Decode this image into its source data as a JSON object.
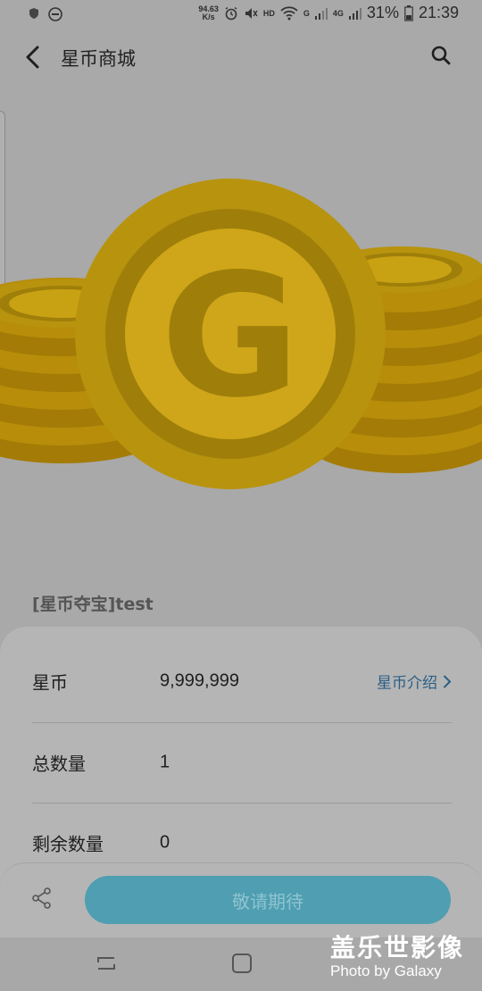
{
  "status_bar": {
    "net_speed_value": "94.63",
    "net_speed_unit": "K/s",
    "hd": "HD",
    "signal_tag_1": "G",
    "signal_tag_2": "4G",
    "battery": "31%",
    "time": "21:39"
  },
  "app_bar": {
    "title": "星币商城",
    "back_icon": "chevron-left-icon",
    "search_icon": "search-icon"
  },
  "hero": {
    "coin_letter": "G",
    "colors": {
      "coin_outer": "#b8930e",
      "coin_ring": "#9f7f0a",
      "coin_face": "#cfa619"
    }
  },
  "product": {
    "title": "[星币夺宝]test"
  },
  "details": {
    "rows": [
      {
        "label": "星币",
        "value": "9,999,999",
        "link": "星币介绍"
      },
      {
        "label": "总数量",
        "value": "1"
      },
      {
        "label": "剩余数量",
        "value": "0"
      }
    ]
  },
  "bottom_bar": {
    "share_icon": "share-icon",
    "cta_label": "敬请期待",
    "cta_color": "#4f9eb1"
  },
  "watermark": {
    "cn": "盖乐世影像",
    "en": "Photo by Galaxy"
  }
}
